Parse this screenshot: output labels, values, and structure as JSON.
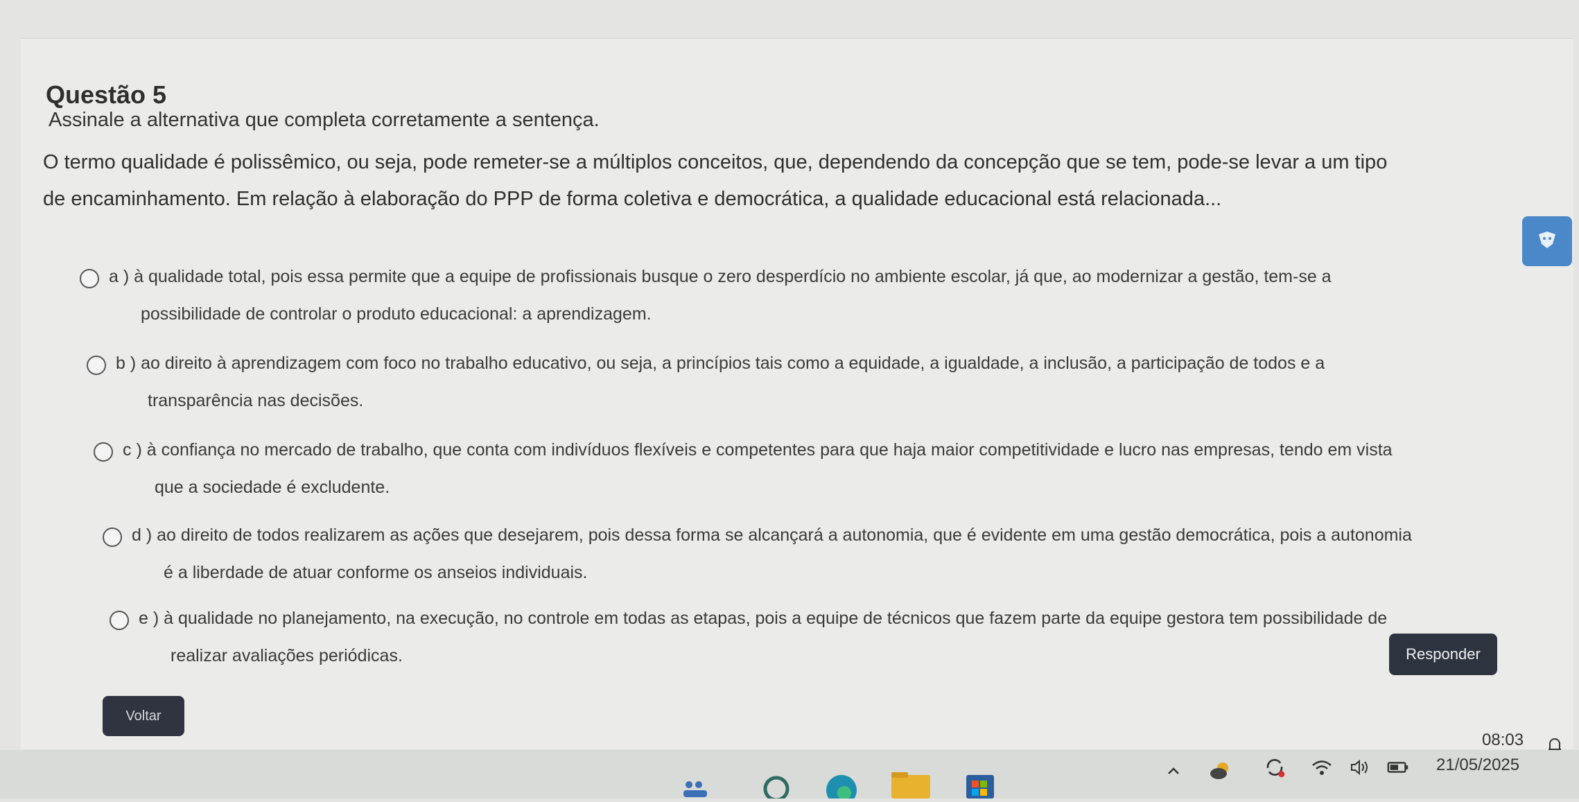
{
  "question": {
    "title": "Questão 5",
    "instruction": "Assinale a alternativa que completa corretamente a sentença.",
    "stem_line1": "O termo qualidade é polissêmico, ou seja, pode remeter-se a múltiplos conceitos, que, dependendo da concepção que se tem, pode-se levar a um tipo",
    "stem_line2": "de encaminhamento. Em relação à elaboração do PPP de forma coletiva e democrática, a qualidade educacional está relacionada..."
  },
  "options": [
    {
      "line1": "a ) à qualidade total, pois essa permite que a equipe de profissionais busque o zero desperdício no ambiente escolar, já que, ao modernizar a gestão, tem-se a",
      "line2": "possibilidade de controlar o produto educacional: a aprendizagem."
    },
    {
      "line1": "b ) ao direito à aprendizagem com foco no trabalho educativo, ou seja, a princípios tais como a equidade, a igualdade, a inclusão, a participação de todos e a",
      "line2": "transparência nas decisões."
    },
    {
      "line1": "c ) à confiança no mercado de trabalho, que conta com indivíduos flexíveis e competentes para que haja maior competitividade e lucro nas empresas, tendo em vista",
      "line2": "que a sociedade é excludente."
    },
    {
      "line1": "d ) ao direito de todos realizarem as ações que desejarem, pois dessa forma se alcançará a autonomia, que é evidente em uma gestão democrática, pois a autonomia",
      "line2": "é a liberdade de atuar conforme os anseios individuais."
    },
    {
      "line1": "e ) à qualidade no planejamento, na execução, no controle em todas as etapas, pois a equipe de técnicos que fazem parte da equipe gestora tem possibilidade de",
      "line2": "realizar avaliações periódicas."
    }
  ],
  "buttons": {
    "responder": "Responder",
    "voltar": "Voltar"
  },
  "taskbar": {
    "time": "08:03",
    "date": "21/05/2025",
    "tray_icons": [
      "chevron-up-icon",
      "weather-icon",
      "sync-icon",
      "wifi-icon",
      "speaker-icon",
      "battery-icon",
      "notification-bell-icon"
    ]
  },
  "colors": {
    "button_dark": "#2d3440",
    "chat_button": "#4a88c9",
    "page_bg": "#ebebea"
  }
}
